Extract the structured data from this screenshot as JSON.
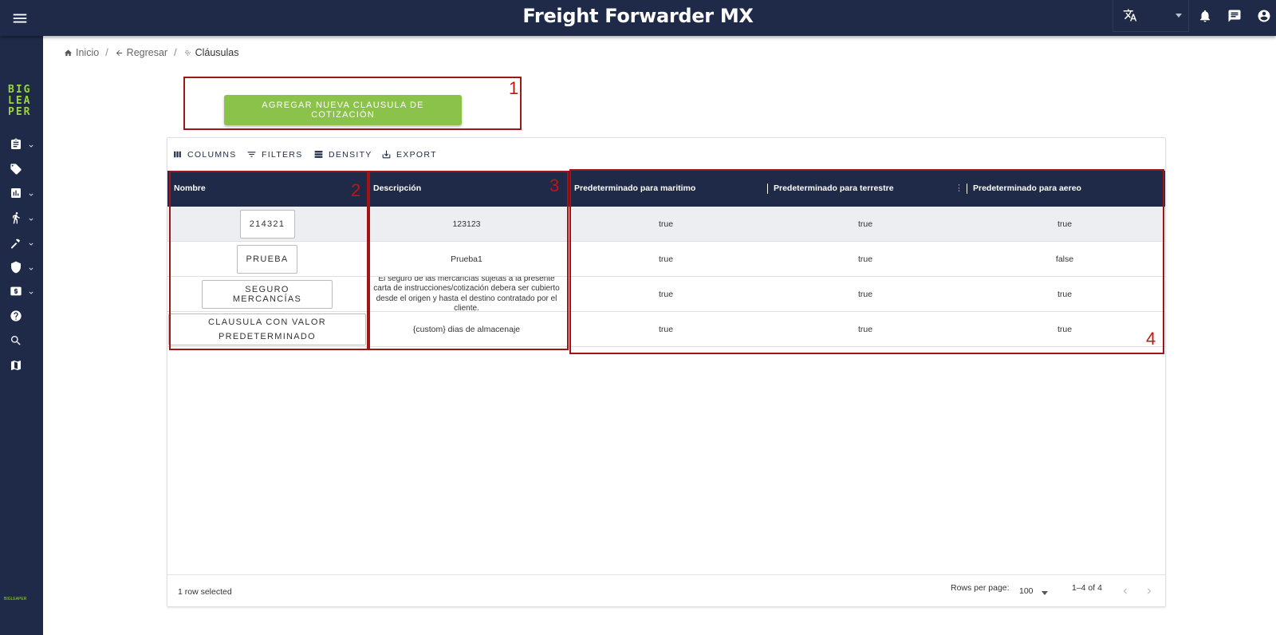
{
  "app": {
    "title": "Freight Forwarder MX"
  },
  "sidebar": {
    "logo": [
      "BIG",
      "LEA",
      "PER"
    ],
    "footer_text": "BIGLEAPER"
  },
  "breadcrumb": {
    "home": "Inicio",
    "back": "Regresar",
    "current": "Cláusulas"
  },
  "actions": {
    "add_clause": "AGREGAR NUEVA CLAUSULA DE COTIZACIÓN"
  },
  "annotations": [
    "1",
    "2",
    "3",
    "4"
  ],
  "toolbar": {
    "columns": "COLUMNS",
    "filters": "FILTERS",
    "density": "DENSITY",
    "export": "EXPORT"
  },
  "table": {
    "columns": [
      "Nombre",
      "Descripción",
      "Predeterminado para maritimo",
      "Predeterminado para terrestre",
      "Predeterminado para aereo"
    ],
    "rows": [
      {
        "nombre": "214321",
        "descripcion": "123123",
        "maritimo": "true",
        "terrestre": "true",
        "aereo": "true",
        "selected": true
      },
      {
        "nombre": "PRUEBA",
        "descripcion": "Prueba1",
        "maritimo": "true",
        "terrestre": "true",
        "aereo": "false",
        "selected": false
      },
      {
        "nombre": "SEGURO MERCANCÍAS",
        "descripcion": "El seguro de las mercancías sujetas a la presente carta de instrucciones/cotización debera ser cubierto desde el origen y hasta el destino contratado por el cliente.",
        "maritimo": "true",
        "terrestre": "true",
        "aereo": "true",
        "selected": false
      },
      {
        "nombre": "CLAUSULA CON VALOR PREDETERMINADO",
        "descripcion": "{custom} dias de almacenaje",
        "maritimo": "true",
        "terrestre": "true",
        "aereo": "true",
        "selected": false
      }
    ]
  },
  "footer": {
    "selected_text": "1 row selected",
    "rows_per_page_label": "Rows per page:",
    "rows_per_page_value": "100",
    "range": "1–4 of 4"
  },
  "colors": {
    "nav_bg": "#1e2a47",
    "accent_green": "#8bc34a",
    "logo_green": "#9bd63a",
    "annotation_red": "#a01616"
  }
}
